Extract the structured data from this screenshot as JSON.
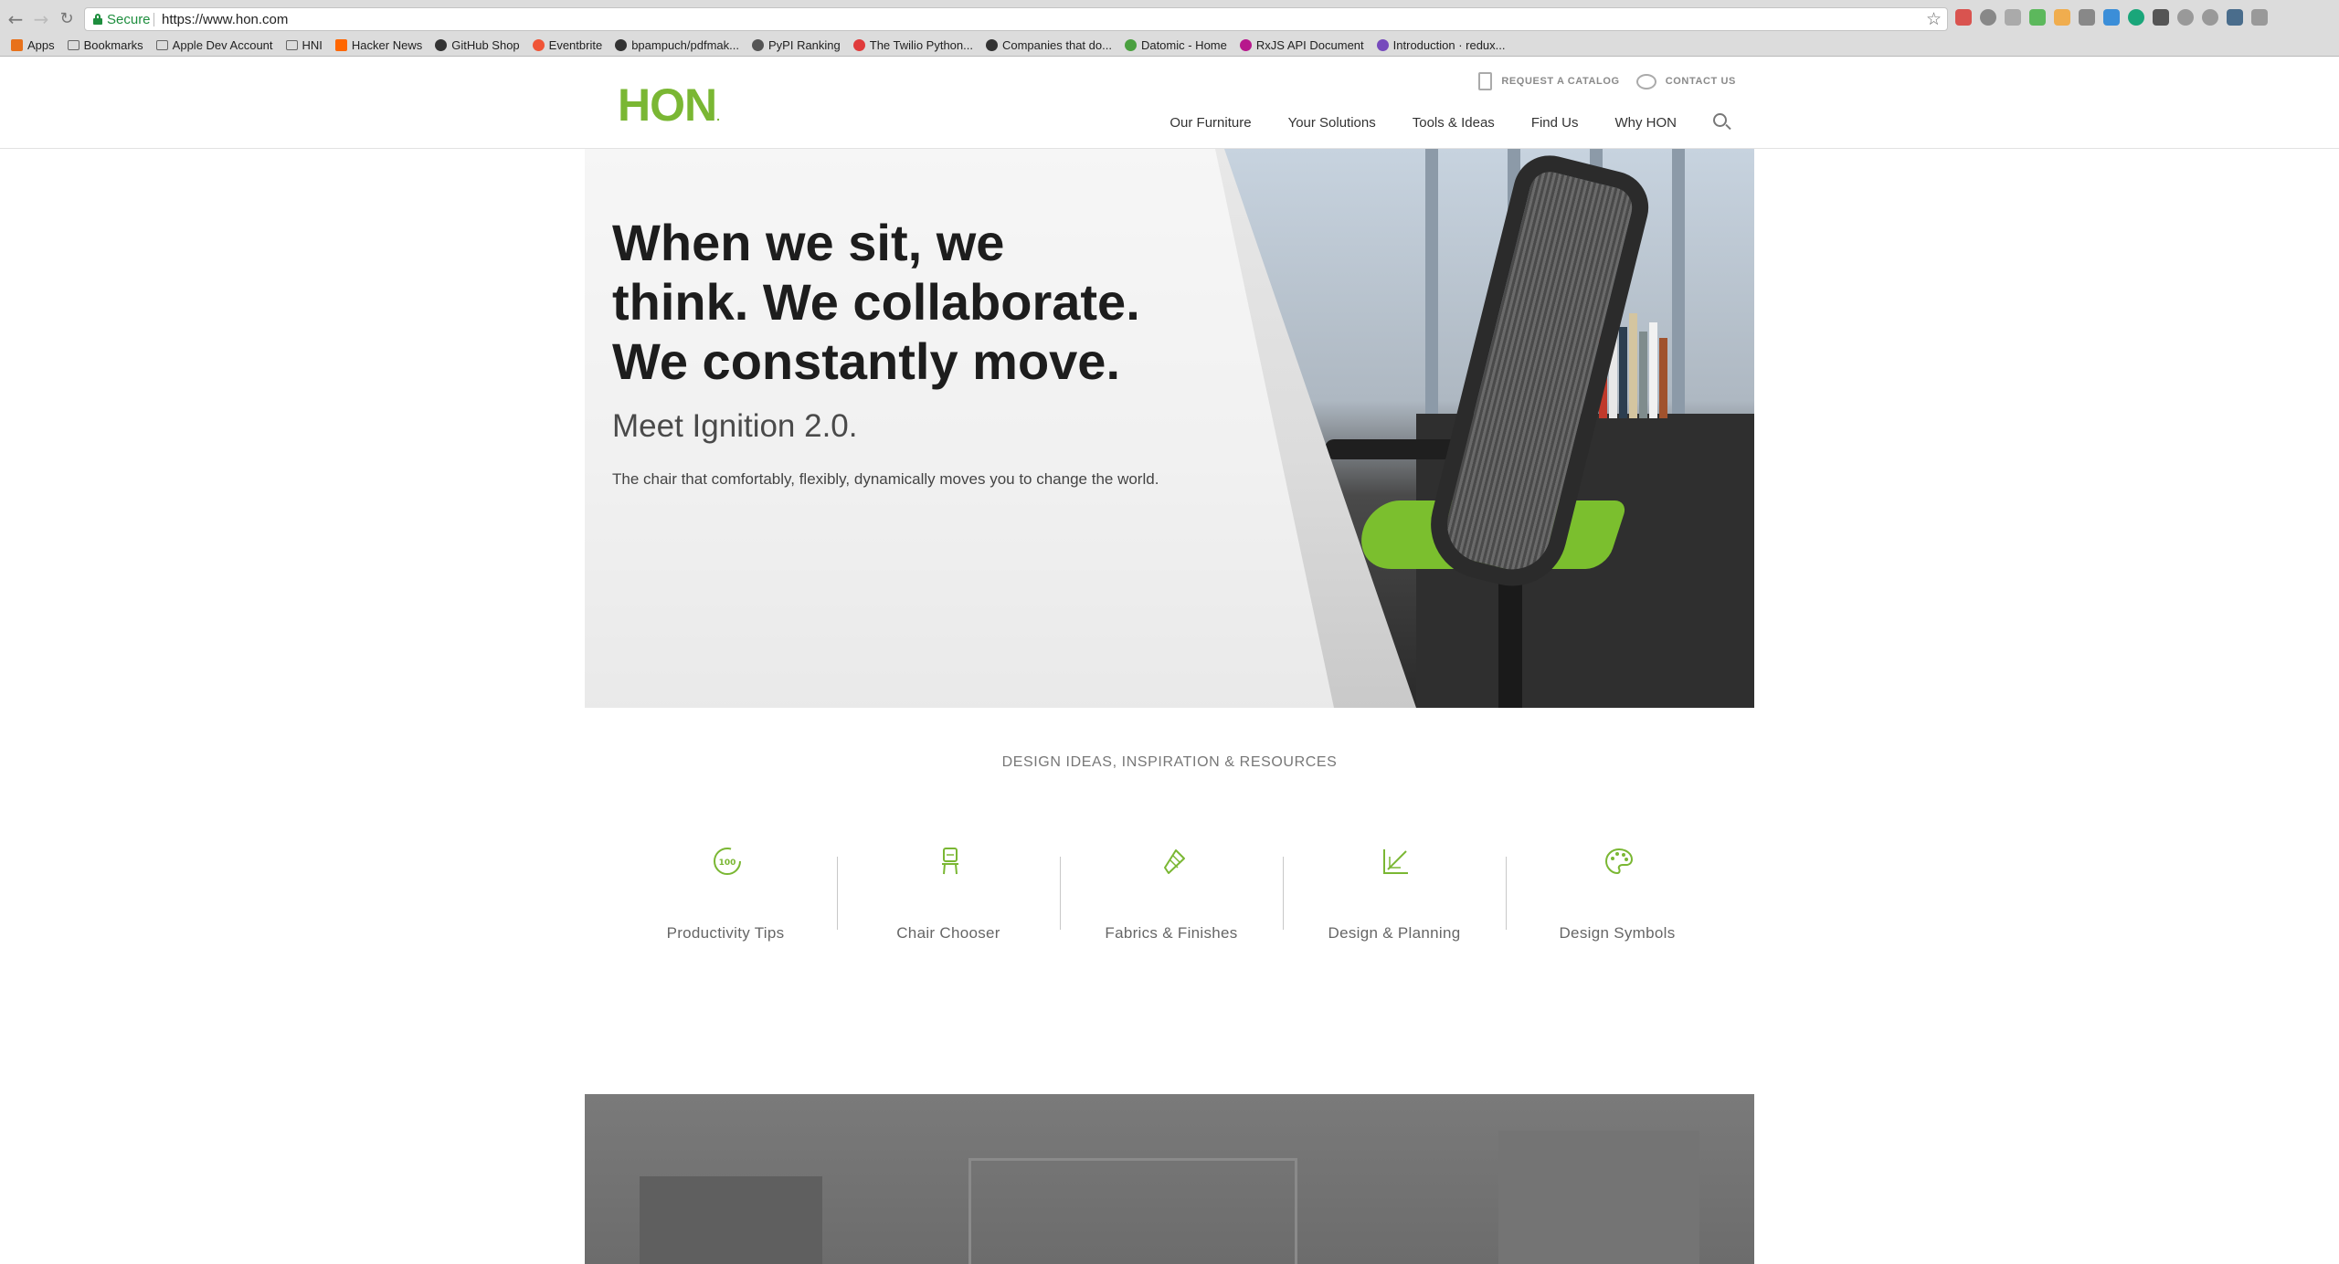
{
  "browser": {
    "secure_label": "Secure",
    "url": "https://www.hon.com",
    "bookmarks": [
      {
        "label": "Apps",
        "icon": "apps-grid-icon",
        "color": "#e8711a"
      },
      {
        "label": "Bookmarks",
        "icon": "folder-icon",
        "color": "#666666"
      },
      {
        "label": "Apple Dev Account",
        "icon": "folder-icon",
        "color": "#666666"
      },
      {
        "label": "HNI",
        "icon": "folder-icon",
        "color": "#666666"
      },
      {
        "label": "Hacker News",
        "icon": "hacker-news-icon",
        "color": "#ff6600"
      },
      {
        "label": "GitHub Shop",
        "icon": "github-icon",
        "color": "#333333"
      },
      {
        "label": "Eventbrite",
        "icon": "eventbrite-icon",
        "color": "#f05537"
      },
      {
        "label": "bpampuch/pdfmak...",
        "icon": "github-icon",
        "color": "#333333"
      },
      {
        "label": "PyPI Ranking",
        "icon": "pypi-icon",
        "color": "#555555"
      },
      {
        "label": "The Twilio Python...",
        "icon": "twilio-icon",
        "color": "#e03b3b"
      },
      {
        "label": "Companies that do...",
        "icon": "github-icon",
        "color": "#333333"
      },
      {
        "label": "Datomic - Home",
        "icon": "datomic-icon",
        "color": "#4aa03f"
      },
      {
        "label": "RxJS API Document",
        "icon": "rxjs-icon",
        "color": "#b7178c"
      },
      {
        "label": "Introduction · redux...",
        "icon": "redux-icon",
        "color": "#764abc"
      }
    ]
  },
  "header": {
    "logo": "HON",
    "util_nav": {
      "catalog": "REQUEST A CATALOG",
      "contact": "CONTACT US"
    },
    "main_nav": [
      "Our Furniture",
      "Your Solutions",
      "Tools & Ideas",
      "Find Us",
      "Why HON"
    ]
  },
  "hero": {
    "headline_line1": "When we sit, we",
    "headline_line2": "think. We collaborate.",
    "headline_line3": "We constantly move.",
    "subheading": "Meet Ignition 2.0.",
    "body": "The chair that comfortably, flexibly, dynamically moves you to change the world."
  },
  "resources": {
    "title": "DESIGN IDEAS, INSPIRATION & RESOURCES",
    "accent_color": "#7ab733",
    "items": [
      {
        "label": "Productivity Tips",
        "icon": "productivity-gauge-icon"
      },
      {
        "label": "Chair Chooser",
        "icon": "chair-icon"
      },
      {
        "label": "Fabrics & Finishes",
        "icon": "fabric-swatch-icon"
      },
      {
        "label": "Design & Planning",
        "icon": "design-ruler-icon"
      },
      {
        "label": "Design Symbols",
        "icon": "palette-icon"
      }
    ]
  }
}
